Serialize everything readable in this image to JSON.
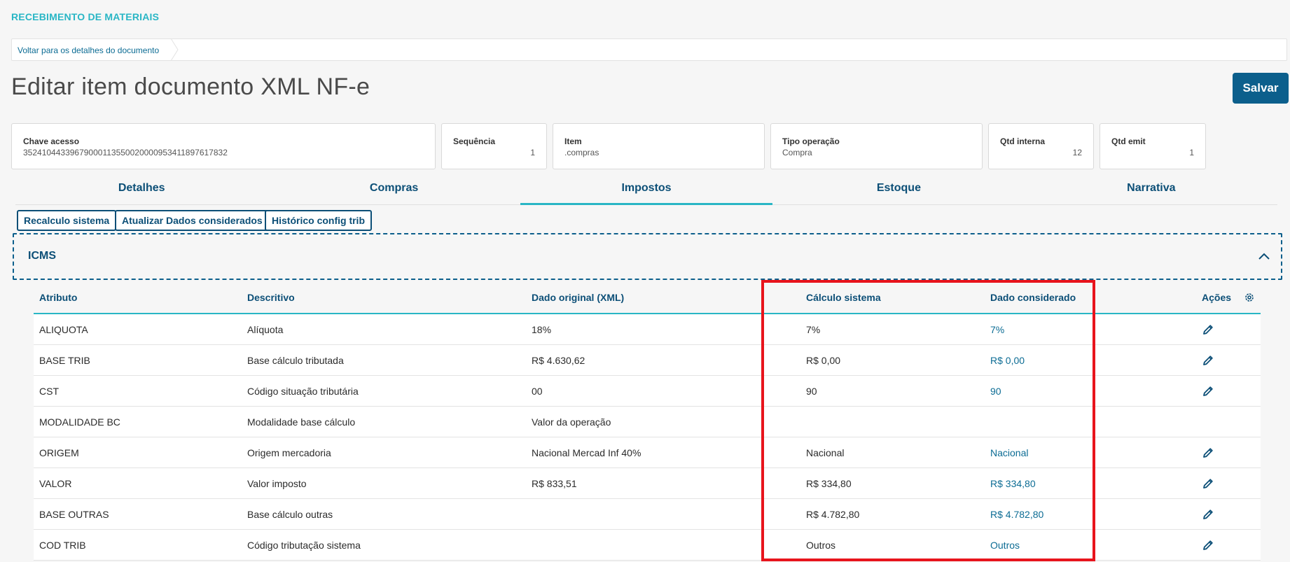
{
  "app": {
    "title": "RECEBIMENTO DE MATERIAIS"
  },
  "breadcrumb": {
    "link": "Voltar para os detalhes do documento"
  },
  "page": {
    "title": "Editar item documento XML NF-e",
    "save_label": "Salvar"
  },
  "cards": [
    {
      "label": "Chave acesso",
      "value": "35241044339679000113550020000953411897617832"
    },
    {
      "label": "Sequência",
      "value": "1"
    },
    {
      "label": "Item",
      "value": ".compras"
    },
    {
      "label": "Tipo operação",
      "value": "Compra"
    },
    {
      "label": "Qtd interna",
      "value": "12"
    },
    {
      "label": "Qtd emit",
      "value": "1"
    }
  ],
  "tabs": [
    {
      "label": "Detalhes",
      "active": false
    },
    {
      "label": "Compras",
      "active": false
    },
    {
      "label": "Impostos",
      "active": true
    },
    {
      "label": "Estoque",
      "active": false
    },
    {
      "label": "Narrativa",
      "active": false
    }
  ],
  "actions": {
    "recalc": "Recalculo sistema",
    "update": "Atualizar Dados considerados",
    "history": "Histórico config trib"
  },
  "section": {
    "title": "ICMS"
  },
  "table": {
    "headers": {
      "atributo": "Atributo",
      "descritivo": "Descritivo",
      "original": "Dado original (XML)",
      "calculo": "Cálculo sistema",
      "considerado": "Dado considerado",
      "acoes": "Ações"
    },
    "rows": [
      {
        "atributo": "ALIQUOTA",
        "descritivo": "Alíquota",
        "original": "18%",
        "calculo": "7%",
        "considerado": "7%",
        "editable": true
      },
      {
        "atributo": "BASE TRIB",
        "descritivo": "Base cálculo tributada",
        "original": "R$ 4.630,62",
        "calculo": "R$ 0,00",
        "considerado": "R$ 0,00",
        "editable": true
      },
      {
        "atributo": "CST",
        "descritivo": "Código situação tributária",
        "original": "00",
        "calculo": "90",
        "considerado": "90",
        "editable": true
      },
      {
        "atributo": "MODALIDADE BC",
        "descritivo": "Modalidade base cálculo",
        "original": "Valor da operação",
        "calculo": "",
        "considerado": "",
        "editable": false
      },
      {
        "atributo": "ORIGEM",
        "descritivo": "Origem mercadoria",
        "original": "Nacional Mercad Inf 40%",
        "calculo": "Nacional",
        "considerado": "Nacional",
        "editable": true
      },
      {
        "atributo": "VALOR",
        "descritivo": "Valor imposto",
        "original": "R$ 833,51",
        "calculo": "R$ 334,80",
        "considerado": "R$ 334,80",
        "editable": true
      },
      {
        "atributo": "BASE OUTRAS",
        "descritivo": "Base cálculo outras",
        "original": "",
        "calculo": "R$ 4.782,80",
        "considerado": "R$ 4.782,80",
        "editable": true
      },
      {
        "atributo": "COD TRIB",
        "descritivo": "Código tributação sistema",
        "original": "",
        "calculo": "Outros",
        "considerado": "Outros",
        "editable": true
      }
    ]
  },
  "colors": {
    "accent": "#29b6c5",
    "primary": "#0c5f8c",
    "highlight": "#e8141c"
  }
}
